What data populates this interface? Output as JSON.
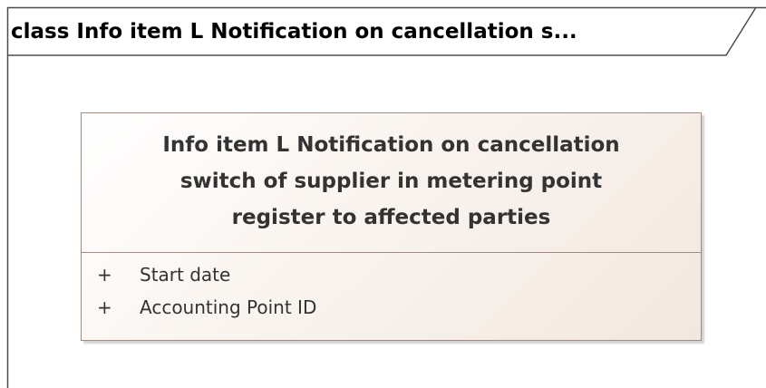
{
  "frame": {
    "title": "class Info item L Notification on cancellation s..."
  },
  "class_element": {
    "name_lines": [
      "Info item L Notification on cancellation",
      "switch of supplier in metering point",
      "register to affected parties"
    ],
    "attributes": [
      {
        "visibility": "+",
        "name": "Start date"
      },
      {
        "visibility": "+",
        "name": "Accounting Point ID"
      }
    ]
  },
  "colors": {
    "frame_stroke": "#4d4d4d",
    "class_border": "#a08c80",
    "class_fill_light": "#ffffff",
    "class_fill_dark": "#f2e7df",
    "text": "#333333"
  }
}
